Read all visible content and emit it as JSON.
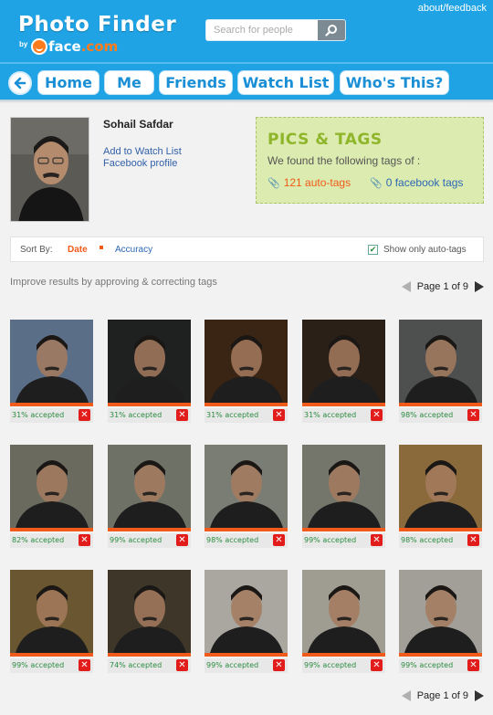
{
  "header": {
    "about_feedback": "about/feedback",
    "app_title": "Photo Finder",
    "by_text": "by",
    "brand_name": "face",
    "brand_tld": ".com",
    "search_placeholder": "Search for people"
  },
  "nav": {
    "items": [
      "Home",
      "Me",
      "Friends",
      "Watch List",
      "Who's This?"
    ]
  },
  "profile": {
    "name": "Sohail Safdar",
    "add_watchlist": "Add to Watch List",
    "facebook_profile": "Facebook profile"
  },
  "tags_panel": {
    "title": "PICS & TAGS",
    "subtitle": "We found the following tags of :",
    "auto_tags": "121 auto-tags",
    "facebook_tags": "0 facebook tags"
  },
  "sort": {
    "label": "Sort By:",
    "date": "Date",
    "accuracy": "Accuracy",
    "only_auto": "Show only auto-tags",
    "only_auto_checked": true
  },
  "hint": "Improve results by approving & correcting tags",
  "pager": {
    "label": "Page 1 of 9"
  },
  "photos": [
    {
      "status": "31% accepted",
      "bg": "#5a6e88"
    },
    {
      "status": "31% accepted",
      "bg": "#1e211f"
    },
    {
      "status": "31% accepted",
      "bg": "#3a2515"
    },
    {
      "status": "31% accepted",
      "bg": "#2a2018"
    },
    {
      "status": "98% accepted",
      "bg": "#4e5050"
    },
    {
      "status": "82% accepted",
      "bg": "#6b6a5e"
    },
    {
      "status": "99% accepted",
      "bg": "#6e7166"
    },
    {
      "status": "98% accepted",
      "bg": "#7a7d74"
    },
    {
      "status": "99% accepted",
      "bg": "#74766c"
    },
    {
      "status": "98% accepted",
      "bg": "#8a6a3a"
    },
    {
      "status": "99% accepted",
      "bg": "#6a5630"
    },
    {
      "status": "74% accepted",
      "bg": "#3e3628"
    },
    {
      "status": "99% accepted",
      "bg": "#a9a79f"
    },
    {
      "status": "99% accepted",
      "bg": "#9f9c92"
    },
    {
      "status": "99% accepted",
      "bg": "#a19f97"
    }
  ],
  "colors": {
    "header_blue": "#1fa3e4",
    "accent_orange": "#f05a1a",
    "accepted_green": "#2a8c3f",
    "reject_red": "#e21b1b"
  }
}
